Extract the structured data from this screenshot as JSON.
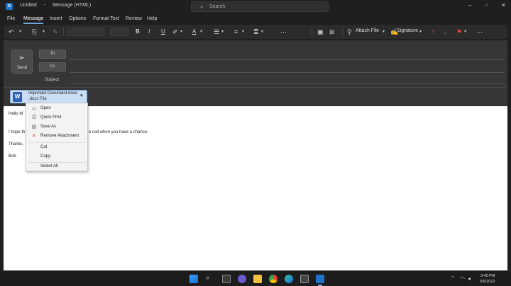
{
  "titlebar": {
    "app_icon": "outlook-icon",
    "doc_title": "Untitled",
    "separator": "-",
    "window_type": "Message (HTML)",
    "search_placeholder": "Search"
  },
  "menu": [
    "File",
    "Message",
    "Insert",
    "Options",
    "Format Text",
    "Review",
    "Help"
  ],
  "ribbon": {
    "attach_file_label": "Attach File",
    "signature_label": "Signature",
    "font_size": "11"
  },
  "compose": {
    "send_label": "Send",
    "to_label": "To",
    "cc_label": "Cc",
    "subject_label": "Subject"
  },
  "attachment": {
    "name": "Important Document.docx",
    "type": ".docx File",
    "icon": "word-icon"
  },
  "body": {
    "line1": "Hello M",
    "line2_start": "I hope th",
    "line2_end": "e call when you have a chance.",
    "line3": "Thanks,",
    "line4": "Bob"
  },
  "context_menu": [
    {
      "label": "Open",
      "icon": "open-icon"
    },
    {
      "label": "Quick Print",
      "icon": "print-icon"
    },
    {
      "label": "Save As",
      "icon": "save-icon"
    },
    {
      "label": "Remove Attachment",
      "icon": "remove-icon"
    },
    {
      "label": "Cut",
      "icon": "cut-icon"
    },
    {
      "label": "Copy",
      "icon": "copy-icon"
    },
    {
      "label": "Select All",
      "icon": "select-all-icon"
    }
  ],
  "taskbar": {
    "time": "3:40 PM",
    "date": "5/6/2022"
  },
  "colors": {
    "accent": "#6fa8dc",
    "attachment_bg": "#c9ddf4",
    "word_blue": "#2b5fb4"
  }
}
